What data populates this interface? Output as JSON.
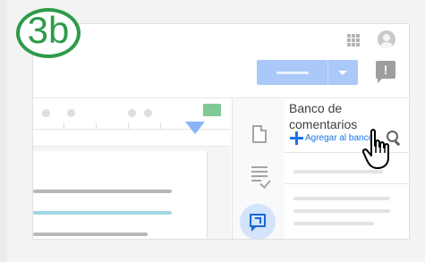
{
  "badge": {
    "text": "3b"
  },
  "colors": {
    "badge_green": "#2e9b4a",
    "accent_blue": "#1a73e8",
    "panel_active_bg": "#d2e3fc",
    "primary_button": "#aac8f8",
    "highlight_line": "#9fd6e4"
  },
  "header": {
    "icons": [
      "apps-grid-icon",
      "account-avatar-icon",
      "feedback-icon"
    ],
    "primary_button": "split-action-button"
  },
  "side_panel": {
    "tools": [
      {
        "name": "document-icon",
        "active": false
      },
      {
        "name": "rubric-checklist-icon",
        "active": false
      },
      {
        "name": "comment-bank-icon",
        "active": true
      }
    ]
  },
  "comment_bank": {
    "title": "Banco de comentarios",
    "add_label": "Agregar al banco",
    "search_icon": "search-icon"
  },
  "cursor": {
    "type": "hand-pointer",
    "target": "search-icon"
  }
}
